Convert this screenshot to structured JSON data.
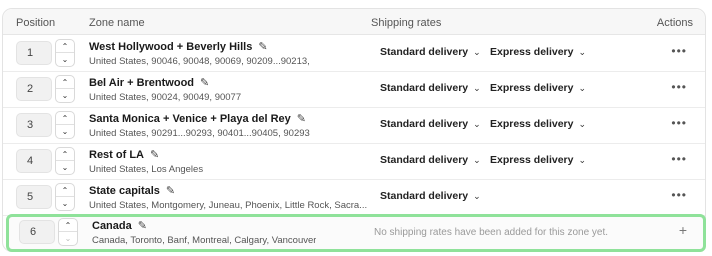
{
  "table": {
    "headers": {
      "position": "Position",
      "zone_name": "Zone name",
      "shipping_rates": "Shipping rates",
      "actions": "Actions"
    },
    "rows": [
      {
        "position": "1",
        "name": "West Hollywood + Beverly Hills",
        "desc": "United States, 90046, 90048, 90069, 90209...90213,",
        "standard": "Standard delivery",
        "express": "Express delivery"
      },
      {
        "position": "2",
        "name": "Bel Air + Brentwood",
        "desc": "United States, 90024, 90049, 90077",
        "standard": "Standard delivery",
        "express": "Express delivery"
      },
      {
        "position": "3",
        "name": "Santa Monica + Venice + Playa del Rey",
        "desc": "United States, 90291...90293, 90401...90405, 90293",
        "standard": "Standard delivery",
        "express": "Express delivery"
      },
      {
        "position": "4",
        "name": "Rest of LA",
        "desc": "United States, Los Angeles",
        "standard": "Standard delivery",
        "express": "Express delivery"
      },
      {
        "position": "5",
        "name": "State capitals",
        "desc": "United States, Montgomery, Juneau, Phoenix, Little Rock, Sacra...",
        "standard": "Standard delivery"
      },
      {
        "position": "6",
        "name": "Canada",
        "desc": "Canada, Toronto, Banf, Montreal, Calgary, Vancouver",
        "no_rates": "No shipping rates have been added for this zone yet."
      }
    ]
  },
  "icons": {
    "edit": "pencil-icon",
    "chevron": "chevron-down-icon",
    "up": "chevron-up-icon",
    "down": "chevron-down-icon",
    "more": "more-horizontal-icon",
    "add": "plus-icon"
  },
  "colors": {
    "highlight_border": "#8fe29a"
  }
}
